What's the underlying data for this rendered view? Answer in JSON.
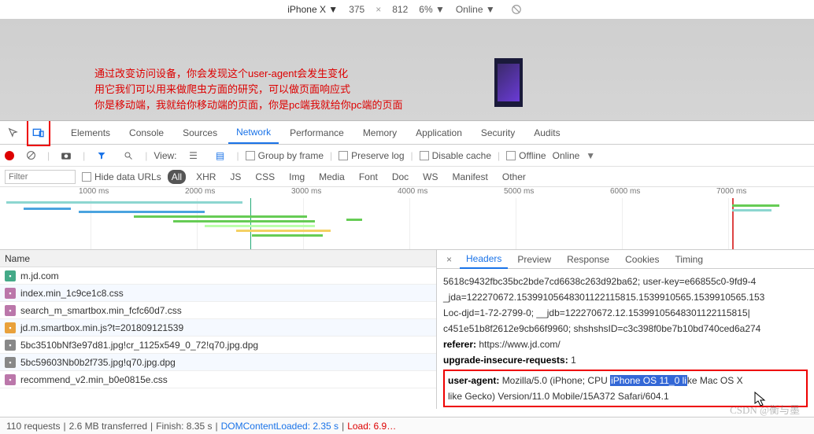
{
  "deviceBar": {
    "device": "iPhone X ▼",
    "width": "375",
    "sep": "×",
    "height": "812",
    "zoom": "6% ▼",
    "throttle": "Online ▼"
  },
  "annotation": {
    "line1": "通过改变访问设备，你会发现这个user-agent会发生变化",
    "line2": "用它我们可以用来做爬虫方面的研究，可以做页面响应式",
    "line3": "你是移动端，我就给你移动端的页面，你是pc端我就给你pc端的页面"
  },
  "tabs": [
    "Elements",
    "Console",
    "Sources",
    "Network",
    "Performance",
    "Memory",
    "Application",
    "Security",
    "Audits"
  ],
  "activeTab": "Network",
  "filterBar": {
    "view": "View:",
    "groupByFrame": "Group by frame",
    "preserveLog": "Preserve log",
    "disableCache": "Disable cache",
    "offline": "Offline",
    "online": "Online"
  },
  "filterRow2": {
    "placeholder": "Filter",
    "hideData": "Hide data URLs",
    "types": [
      "All",
      "XHR",
      "JS",
      "CSS",
      "Img",
      "Media",
      "Font",
      "Doc",
      "WS",
      "Manifest",
      "Other"
    ]
  },
  "waterfall": {
    "ticks": [
      "1000 ms",
      "2000 ms",
      "3000 ms",
      "4000 ms",
      "5000 ms",
      "6000 ms",
      "7000 ms"
    ]
  },
  "leftHead": "Name",
  "requests": [
    {
      "icon": "doc",
      "iconBg": "#4a8",
      "name": "m.jd.com"
    },
    {
      "icon": "css",
      "iconBg": "#b7a",
      "name": "index.min_1c9ce1c8.css"
    },
    {
      "icon": "css",
      "iconBg": "#b7a",
      "name": "search_m_smartbox.min_fcfc60d7.css"
    },
    {
      "icon": "js",
      "iconBg": "#e9a13b",
      "name": "jd.m.smartbox.min.js?t=201809121539"
    },
    {
      "icon": "img",
      "iconBg": "#888",
      "name": "5bc3510bNf3e97d81.jpg!cr_1125x549_0_72!q70.jpg.dpg"
    },
    {
      "icon": "img",
      "iconBg": "#888",
      "name": "5bc59603Nb0b2f735.jpg!q70.jpg.dpg"
    },
    {
      "icon": "css",
      "iconBg": "#b7a",
      "name": "recommend_v2.min_b0e0815e.css"
    }
  ],
  "detailTabs": [
    "Headers",
    "Preview",
    "Response",
    "Cookies",
    "Timing"
  ],
  "activeDetailTab": "Headers",
  "headers": {
    "l1": "5618c9432fbc35bc2bde7cd6638c263d92ba62; user-key=e66855c0-9fd9-4",
    "l2": "_jda=122270672.15399105648301122115815.1539910565.1539910565.153",
    "l3": "Loc-djd=1-72-2799-0; __jdb=122270672.12.15399105648301122115815|",
    "l4": "c451e51b8f2612e9cb66f9960; shshshsID=c3c398f0be7b10bd740ced6a274",
    "refererK": "referer:",
    "refererV": "https://www.jd.com/",
    "uirK": "upgrade-insecure-requests:",
    "uirV": "1",
    "uaK": "user-agent:",
    "uaPre": "Mozilla/5.0 (iPhone; CPU ",
    "uaHl": "iPhone OS 11_0 li",
    "uaMid": "ke Mac OS X",
    "uaL2": " like Gecko) Version/11.0 Mobile/15A372 Safari/604.1"
  },
  "status": {
    "requests": "110 requests",
    "transferred": "2.6 MB transferred",
    "finish": "Finish: 8.35 s",
    "dcl": "DOMContentLoaded: 2.35 s",
    "load": "Load: 6.9…"
  },
  "watermark": "CSDN @衡与墨"
}
